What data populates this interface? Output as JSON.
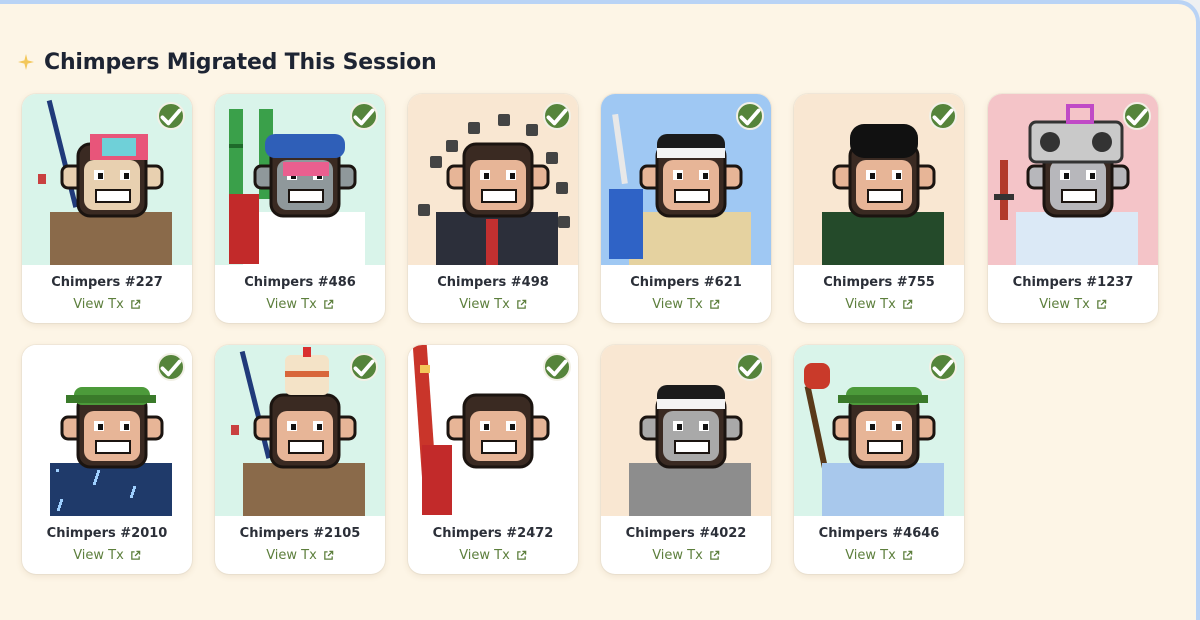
{
  "section": {
    "title": "Chimpers Migrated This Session",
    "icon": "sparkle-icon"
  },
  "colors": {
    "page_background": "#fdf5e6",
    "accent_green": "#55843b",
    "link_green": "#5d7f3d"
  },
  "nfts": [
    {
      "name": "Chimpers #227",
      "link": "View Tx",
      "bg": "#d9f4ea",
      "item": "fishing-rod",
      "hat": "pink-visor",
      "outfit": "brown-cloak",
      "face": "#e8d0b0"
    },
    {
      "name": "Chimpers #486",
      "link": "View Tx",
      "bg": "#d9f4ea",
      "item": "bamboo",
      "hat": "blue-cap",
      "outfit": "red-backpack",
      "face": "#8f989b"
    },
    {
      "name": "Chimpers #498",
      "link": "View Tx",
      "bg": "#f9e7d2",
      "item": "dark-orbs",
      "hat": "bald",
      "outfit": "suit",
      "face": "#e7b597"
    },
    {
      "name": "Chimpers #621",
      "link": "View Tx",
      "bg": "#9fc8f3",
      "item": "feather",
      "hat": "headband",
      "outfit": "blue-backpack",
      "face": "#e7b597"
    },
    {
      "name": "Chimpers #755",
      "link": "View Tx",
      "bg": "#f9e7d2",
      "item": "none",
      "hat": "black-beanie",
      "outfit": "green-robe",
      "face": "#e7b597"
    },
    {
      "name": "Chimpers #1237",
      "link": "View Tx",
      "bg": "#f4c4c8",
      "item": "sword",
      "hat": "boombox",
      "outfit": "ice-scarf",
      "face": "#b7b7bb"
    },
    {
      "name": "Chimpers #2010",
      "link": "View Tx",
      "bg": "#ffffff",
      "item": "none",
      "hat": "leaf-cap",
      "outfit": "starry-cloak",
      "face": "#e7b597"
    },
    {
      "name": "Chimpers #2105",
      "link": "View Tx",
      "bg": "#d9f4ea",
      "item": "fishing-rod",
      "hat": "cake",
      "outfit": "brown-cloak",
      "face": "#e7b597"
    },
    {
      "name": "Chimpers #2472",
      "link": "View Tx",
      "bg": "#ffffff",
      "item": "staff",
      "hat": "none",
      "outfit": "red-backpack",
      "face": "#e7b597"
    },
    {
      "name": "Chimpers #4022",
      "link": "View Tx",
      "bg": "#f9e7d2",
      "item": "none",
      "hat": "headband",
      "outfit": "grey-hoodie",
      "face": "#a9a9a9"
    },
    {
      "name": "Chimpers #4646",
      "link": "View Tx",
      "bg": "#d9f4ea",
      "item": "apple-staff",
      "hat": "leaf-cap",
      "outfit": "slime-blue",
      "face": "#e7b597"
    }
  ]
}
